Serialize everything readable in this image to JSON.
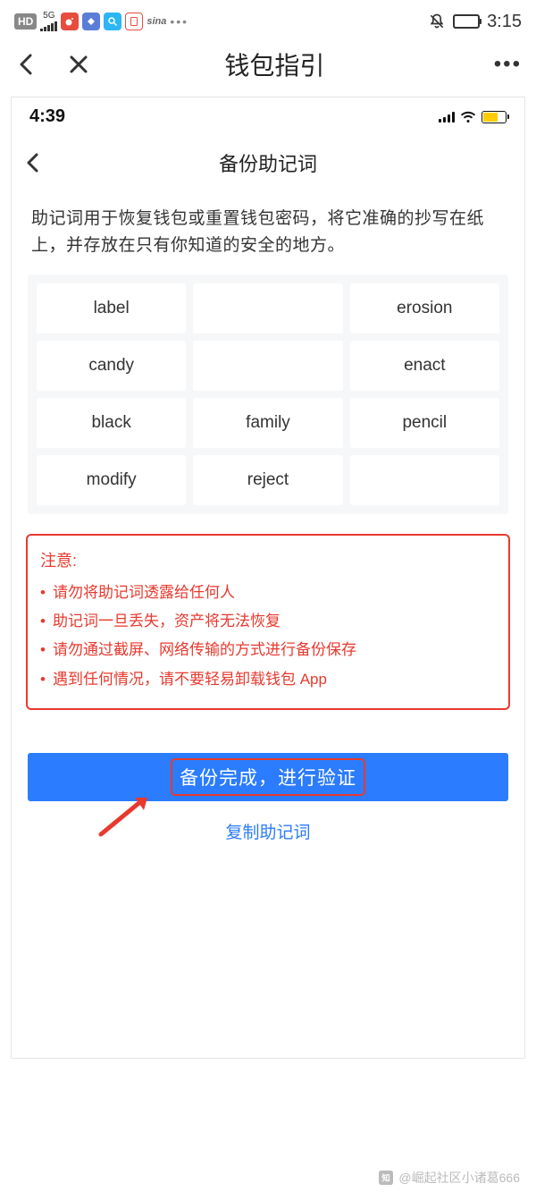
{
  "outer_status": {
    "hd": "HD",
    "network": "5G",
    "time": "3:15"
  },
  "outer_nav": {
    "title": "钱包指引"
  },
  "inner_status": {
    "time": "4:39"
  },
  "inner_nav": {
    "title": "备份助记词"
  },
  "description": "助记词用于恢复钱包或重置钱包密码，将它准确的抄写在纸上，并存放在只有你知道的安全的地方。",
  "words": [
    "label",
    "",
    "erosion",
    "candy",
    "",
    "enact",
    "black",
    "family",
    "pencil",
    "modify",
    "reject",
    ""
  ],
  "notice": {
    "title": "注意:",
    "items": [
      "请勿将助记词透露给任何人",
      "助记词一旦丢失，资产将无法恢复",
      "请勿通过截屏、网络传输的方式进行备份保存",
      "遇到任何情况，请不要轻易卸载钱包 App"
    ]
  },
  "primary_button": "备份完成，进行验证",
  "copy_link": "复制助记词",
  "watermark": "@崛起社区小诸葛666"
}
